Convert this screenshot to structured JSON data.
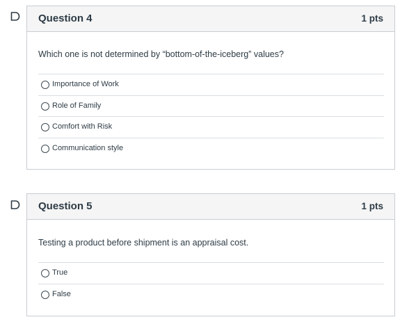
{
  "questions": [
    {
      "title": "Question 4",
      "points": "1 pts",
      "text": "Which one is not determined by “bottom-of-the-iceberg” values?",
      "answers": [
        {
          "label": "Importance of Work"
        },
        {
          "label": "Role of Family"
        },
        {
          "label": "Comfort with Risk"
        },
        {
          "label": "Communication style"
        }
      ]
    },
    {
      "title": "Question 5",
      "points": "1 pts",
      "text": "Testing a product before shipment is an appraisal cost.",
      "answers": [
        {
          "label": "True"
        },
        {
          "label": "False"
        }
      ]
    }
  ],
  "icons": {
    "flag": "flag-question-icon",
    "radio": "radio-empty-icon"
  },
  "colors": {
    "flag": "#2d3b45",
    "border": "#c7cdd1",
    "header_bg": "#f5f5f5",
    "text": "#2d3b45"
  }
}
